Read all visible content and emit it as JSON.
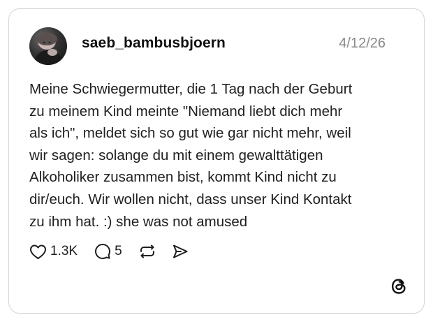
{
  "post": {
    "username": "saeb_bambusbjoern",
    "date": "4/12/26",
    "text": "Meine Schwiegermutter, die 1 Tag nach der Geburt\nzu meinem Kind meinte \"Niemand liebt dich mehr\nals ich\", meldet sich so gut wie gar nicht mehr, weil\nwir sagen: solange du mit einem gewalttätigen\nAlkoholiker zusammen bist, kommt Kind nicht zu\ndir/euch. Wir wollen nicht, dass unser Kind Kontakt\nzu ihm hat. :) she was not amused"
  },
  "actions": {
    "likes": "1.3K",
    "replies": "5"
  },
  "icons": {
    "like": "heart-icon",
    "reply": "comment-icon",
    "repost": "repost-icon",
    "share": "send-icon",
    "brand": "threads-logo"
  }
}
